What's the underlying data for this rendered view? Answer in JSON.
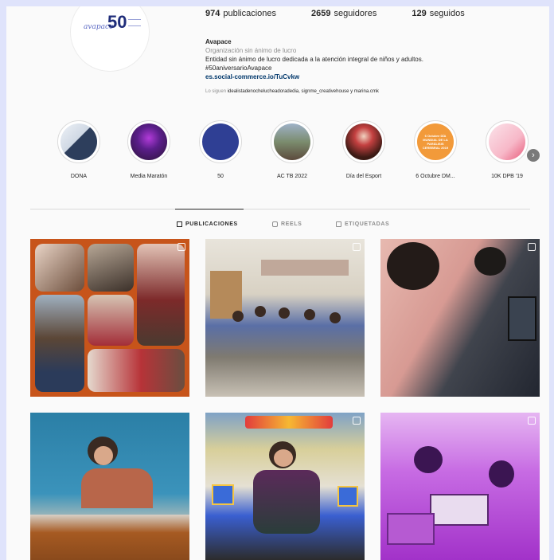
{
  "profile": {
    "logo_script": "avapace",
    "logo_number": "50",
    "stats": {
      "posts_count": "974",
      "posts_label": "publicaciones",
      "followers_count": "2659",
      "followers_label": "seguidores",
      "following_count": "129",
      "following_label": "seguidos"
    },
    "name": "Avapace",
    "category": "Organización sin ánimo de lucro",
    "bio_line1": "Entidad sin ánimo de lucro dedicada a la atención integral de niños y adultos.",
    "bio_line2": "#50aniversarioAvapace",
    "link": "es.social-commerce.io/TuCvkw",
    "followed_by_prefix": "Lo siguen",
    "followed_by_names": "idealistadenochelucheadoradedia, signme_creativehouse y marina.cmk"
  },
  "highlights": [
    {
      "label": "DONA",
      "icon": "dona-highlight"
    },
    {
      "label": "Media Maratón",
      "icon": "media-maraton-highlight"
    },
    {
      "label": "50",
      "icon": "50-highlight"
    },
    {
      "label": "AC TB 2022",
      "icon": "ac-tb-highlight"
    },
    {
      "label": "Día del Esport",
      "icon": "dia-esport-highlight"
    },
    {
      "label": "6 Octubre DM...",
      "icon": "octubre-highlight"
    },
    {
      "label": "10K DPB '19",
      "icon": "10k-highlight"
    }
  ],
  "highlight_cover_text": {
    "octubre": "6 Octubre DÍA MUNDIAL DE LA PARÁLISIS CEREBRAL 2019"
  },
  "tabs": [
    {
      "label": "PUBLICACIONES",
      "icon": "grid-icon",
      "active": true
    },
    {
      "label": "REELS",
      "icon": "reels-icon",
      "active": false
    },
    {
      "label": "ETIQUETADAS",
      "icon": "tagged-icon",
      "active": false
    }
  ],
  "colors": {
    "brand_blue": "#1f2d7a",
    "link_blue": "#00376b",
    "purple_post": "#b13ad6",
    "orange_collage": "#c7541a"
  }
}
